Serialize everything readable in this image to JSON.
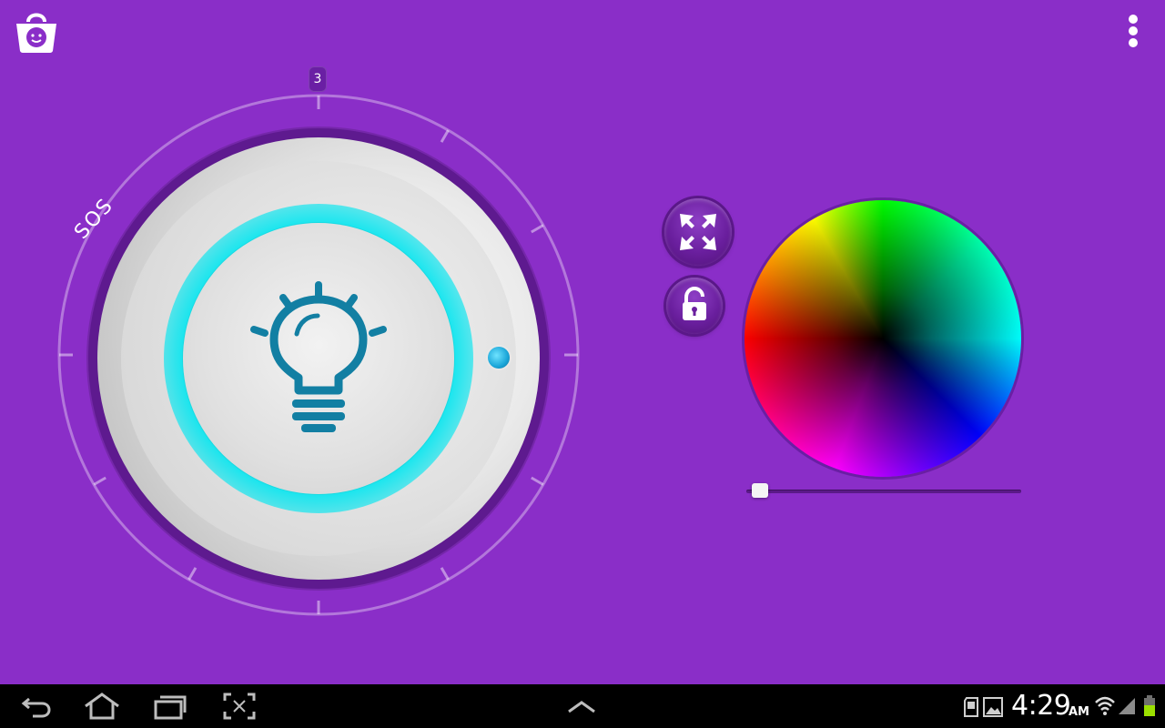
{
  "app": {
    "accent_color": "#8a2ec8",
    "glow_color": "#00e6f0",
    "icons": {
      "store": "shopping-bag-smiley-icon",
      "menu": "overflow-menu-icon",
      "power": "lightbulb-icon",
      "fullscreen": "fullscreen-arrows-icon",
      "lock": "unlock-icon"
    }
  },
  "dial": {
    "level_label": "3",
    "mode_label": "SOS"
  },
  "brightness": {
    "value_fraction": 0.02
  },
  "statusbar": {
    "time": "4:29",
    "ampm": "AM",
    "icons": [
      "sd-card-icon",
      "gallery-icon",
      "wifi-icon",
      "signal-icon",
      "battery-icon"
    ]
  },
  "navbar": {
    "buttons": [
      "back-icon",
      "home-icon",
      "recent-apps-icon",
      "screenshot-icon",
      "up-chevron-icon"
    ]
  }
}
